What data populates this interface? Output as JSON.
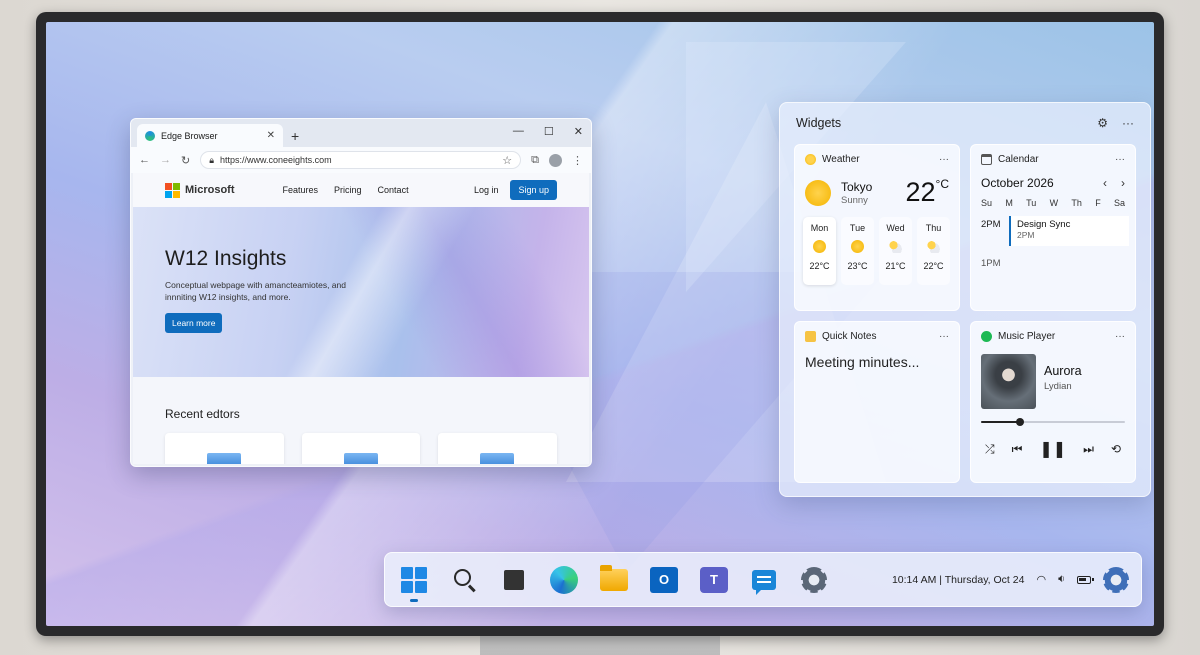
{
  "browser": {
    "tab_title": "Edge Browser",
    "new_tab": "+",
    "close_tab": "✕",
    "window_controls": [
      "—",
      "☐",
      "✕"
    ],
    "url": "https://www.coneeights.com",
    "site": {
      "brand": "Microsoft",
      "logo_colors": [
        "#f25022",
        "#7fba00",
        "#00a4ef",
        "#ffb900"
      ],
      "nav": [
        "Features",
        "Pricing",
        "Contact"
      ],
      "login": "Log in",
      "signup": "Sign up",
      "hero_title": "W12 Insights",
      "hero_text": "Conceptual webpage with amancteamiotes, and innniting W12 insights, and more.",
      "learn_more": "Learn more",
      "recent_title": "Recent edtors"
    }
  },
  "widgets": {
    "title": "Widgets",
    "weather": {
      "title": "Weather",
      "city": "Tokyo",
      "condition": "Sunny",
      "temp": "22",
      "unit": "°C",
      "days": [
        {
          "day": "Mon",
          "temp": "22°C",
          "icon": "sun-icon"
        },
        {
          "day": "Tue",
          "temp": "23°C",
          "icon": "sun-icon"
        },
        {
          "day": "Wed",
          "temp": "21°C",
          "icon": "partly-cloudy-icon"
        },
        {
          "day": "Thu",
          "temp": "22°C",
          "icon": "partly-cloudy-icon"
        }
      ]
    },
    "calendar": {
      "title": "Calendar",
      "month": "October 2026",
      "weekdays": [
        "Su",
        "M",
        "Tu",
        "W",
        "Th",
        "F",
        "Sa"
      ],
      "event_time": "2PM",
      "event_name": "Design Sync",
      "event_sub": "2PM",
      "next_slot": "1PM"
    },
    "notes": {
      "title": "Quick Notes",
      "body": "Meeting minutes..."
    },
    "music": {
      "title": "Music Player",
      "song": "Aurora",
      "artist": "Lydian",
      "progress": 0.27
    }
  },
  "taskbar": {
    "clock": "10:14 AM | Thursday, Oct 24"
  },
  "colors": {
    "accent": "#0f6cbd"
  }
}
